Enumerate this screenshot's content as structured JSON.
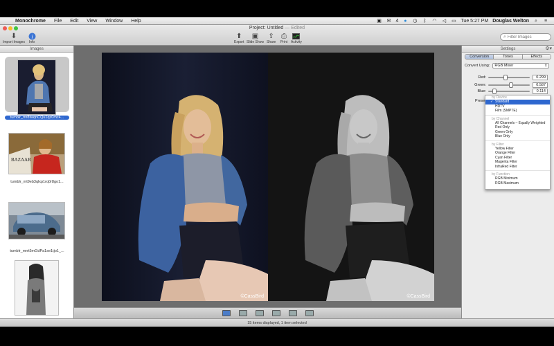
{
  "menubar": {
    "app_name": "Monochrome",
    "menus": [
      "File",
      "Edit",
      "View",
      "Window",
      "Help"
    ],
    "clock": "Tue 5:27 PM",
    "user": "Douglas Welton",
    "badge_count": "4"
  },
  "window": {
    "title_prefix": "Project: Untitled",
    "title_suffix": "— Edited"
  },
  "toolbar": {
    "import_label": "Import Images",
    "info_label": "Info",
    "export_label": "Export",
    "slideshow_label": "Slide Show",
    "share_label": "Share",
    "print_label": "Print",
    "activity_label": "Activity",
    "search_placeholder": "Filter Images"
  },
  "sidebar": {
    "title": "Images",
    "items": [
      {
        "caption": "tumblr_mr8twqnCQu1qz0mc4..."
      },
      {
        "caption": "tumblr_mt9eb3qlxp1rq0r8go1..."
      },
      {
        "caption": "tumblr_mrrt5mGdPa1se1tjo1_..."
      },
      {
        "caption": ""
      }
    ]
  },
  "canvas": {
    "copyright": "©CassBird"
  },
  "statusbar": {
    "text": "15 items displayed, 1 item selected"
  },
  "settings": {
    "title": "Settings",
    "tabs": [
      "Conversion",
      "Tones",
      "Effects"
    ],
    "convert_label": "Convert Using:",
    "convert_value": "RGB Mixer",
    "red_label": "Red:",
    "red_value": "0.299",
    "red_level": 0.4,
    "green_label": "Green:",
    "green_value": "0.587",
    "green_level": 0.55,
    "blue_label": "Blue:",
    "blue_value": "0.114",
    "blue_level": 0.12,
    "presets_label": "Presets:"
  },
  "preset_menu": {
    "groups": [
      {
        "header": "by Device",
        "items": [
          "Standard",
          "HDTV",
          "Film (SMPTE)"
        ]
      },
      {
        "header": "by Channel",
        "items": [
          "All Channels – Equally Weighted",
          "Red Only",
          "Green Only",
          "Blue Only"
        ]
      },
      {
        "header": "by Filter",
        "items": [
          "Yellow Filter",
          "Orange Filter",
          "Cyan Filter",
          "Magenta Filter",
          "InfraRed Filter"
        ]
      },
      {
        "header": "by Function",
        "items": [
          "RGB Minimum",
          "RGB Maximum"
        ]
      }
    ],
    "selected": "Standard"
  },
  "colors": {
    "selection": "#2e67cf",
    "canvas_bg": "#6e6e6e"
  }
}
